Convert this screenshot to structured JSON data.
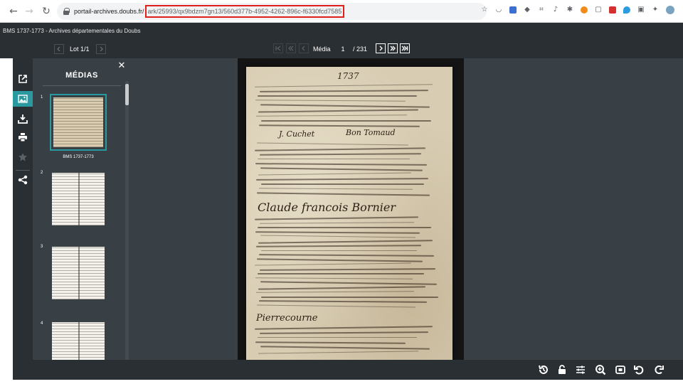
{
  "browser": {
    "url_domain": "portail-archives.doubs.fr/",
    "url_path": "ark/25993/qx9bdzm7gn13/560d377b-4952-4262-896c-f6330fcd7585"
  },
  "header": {
    "title": "BMS 1737-1773 - Archives départementales du Doubs"
  },
  "toolbar": {
    "lot_label": "Lot 1/1",
    "media_label": "Média",
    "media_current": "1",
    "media_total": "/ 231"
  },
  "panel": {
    "title": "MÉDIAS",
    "thumbnails": [
      {
        "number": "1",
        "caption": "BMS 1737-1773"
      },
      {
        "number": "2",
        "caption": ""
      },
      {
        "number": "3",
        "caption": ""
      },
      {
        "number": "4",
        "caption": ""
      }
    ]
  },
  "page": {
    "year": "1737",
    "heading": "Claude francois Bornier",
    "signature_1": "J. Cuchet",
    "signature_2": "Bon Tomaud",
    "signature_3": "Pierrecourne"
  },
  "icons": {
    "toolbar": [
      "external-link-icon",
      "image-icon",
      "download-icon",
      "print-icon",
      "star-icon",
      "share-icon"
    ],
    "bottom": [
      "history-icon",
      "unlock-icon",
      "sliders-icon",
      "zoom-in-icon",
      "fit-screen-icon",
      "rotate-left-icon",
      "rotate-right-icon"
    ]
  },
  "colors": {
    "accent": "#2a9aa0",
    "chrome_dark": "#2a2f33",
    "panel": "#394045",
    "url_highlight": "#e0201e"
  }
}
